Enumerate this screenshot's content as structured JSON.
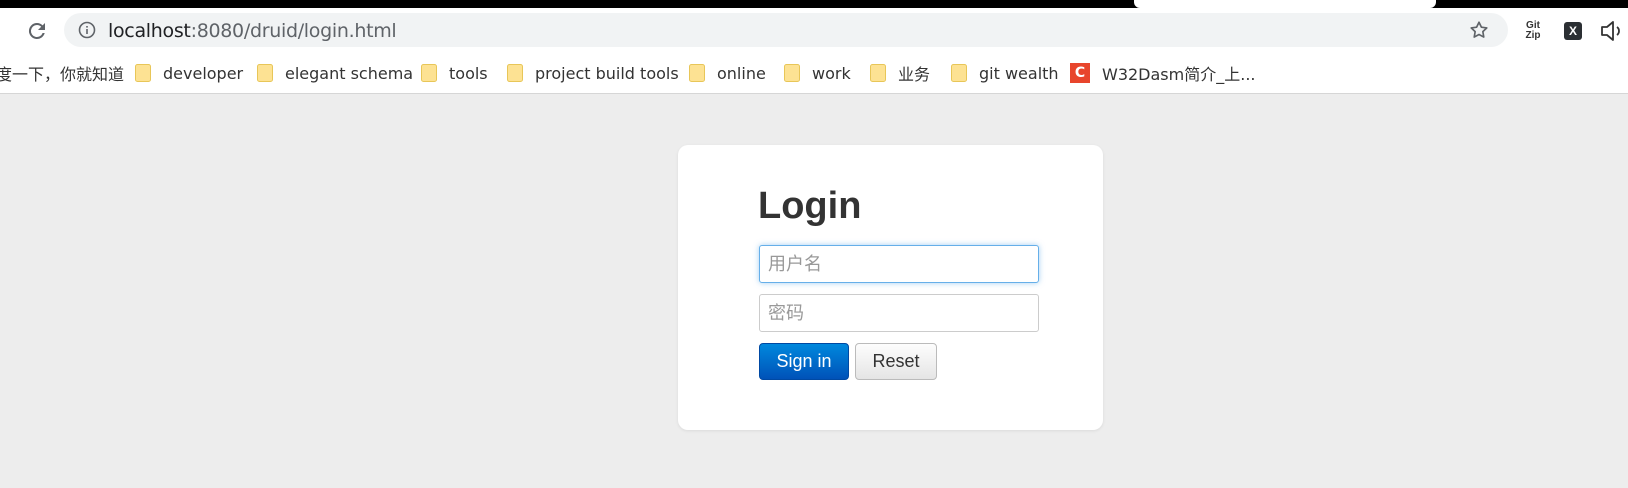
{
  "browser": {
    "url_host": "localhost",
    "url_path": ":8080/druid/login.html",
    "extensions": {
      "gitzip_line1": "Git",
      "gitzip_line2": "Zip",
      "x_label": "X"
    }
  },
  "bookmarks": [
    {
      "label": "度一下，你就知道",
      "icon": "none"
    },
    {
      "label": "developer",
      "icon": "folder-icon"
    },
    {
      "label": "elegant schema",
      "icon": "folder-icon"
    },
    {
      "label": "tools",
      "icon": "folder-icon"
    },
    {
      "label": "project build tools",
      "icon": "folder-icon"
    },
    {
      "label": "online",
      "icon": "folder-icon"
    },
    {
      "label": "work",
      "icon": "folder-icon"
    },
    {
      "label": "业务",
      "icon": "folder-icon"
    },
    {
      "label": "git wealth",
      "icon": "folder-icon"
    },
    {
      "label": "W32Dasm简介_上...",
      "icon": "c-icon",
      "icon_text": "C"
    }
  ],
  "login": {
    "title": "Login",
    "username_placeholder": "用户名",
    "password_placeholder": "密码",
    "signin_label": "Sign in",
    "reset_label": "Reset"
  },
  "colors": {
    "page_bg": "#ededed",
    "primary_button": "#0066cc",
    "focus_border": "#66afe9"
  }
}
